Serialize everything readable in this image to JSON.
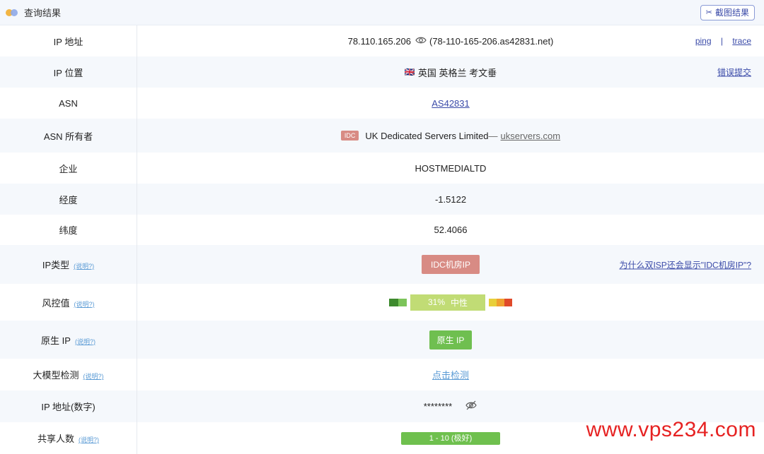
{
  "header": {
    "title": "查询结果",
    "screenshot_button": "截图结果"
  },
  "rows": {
    "ip": {
      "label": "IP 地址",
      "value": "78.110.165.206",
      "hostname": "(78-110-165-206.as42831.net)",
      "ping": "ping",
      "sep": "|",
      "trace": "trace"
    },
    "location": {
      "label": "IP 位置",
      "flag": "🇬🇧",
      "value": "英国 英格兰 考文垂",
      "report": "错误提交"
    },
    "asn": {
      "label": "ASN",
      "value": "AS42831"
    },
    "asn_owner": {
      "label": "ASN 所有者",
      "tag": "IDC",
      "name": "UK Dedicated Servers Limited",
      "dash": "—",
      "site": "ukservers.com"
    },
    "company": {
      "label": "企业",
      "value": "HOSTMEDIALTD"
    },
    "longitude": {
      "label": "经度",
      "value": "-1.5122"
    },
    "latitude": {
      "label": "纬度",
      "value": "52.4066"
    },
    "ip_type": {
      "label": "IP类型",
      "hint": "(说明?)",
      "value": "IDC机房IP",
      "faq": "为什么双ISP还会显示\"IDC机房IP\"?"
    },
    "risk": {
      "label": "风控值",
      "hint": "(说明?)",
      "percent": "31%",
      "level": "中性",
      "level_fraction": 0.31
    },
    "native": {
      "label": "原生 IP",
      "hint": "(说明?)",
      "value": "原生 IP"
    },
    "llm": {
      "label": "大模型检测",
      "hint": "(说明?)",
      "action": "点击检测"
    },
    "ip_numeric": {
      "label": "IP 地址(数字)",
      "value": "********"
    },
    "shared": {
      "label": "共享人数",
      "hint": "(说明?)",
      "value": "1 - 10 (极好)"
    }
  },
  "colors": {
    "accent": "#3a4aa8",
    "idc": "#d88b84",
    "green": "#6fbf50",
    "risk_main": "#c1dc75"
  },
  "watermark": "www.vps234.com"
}
